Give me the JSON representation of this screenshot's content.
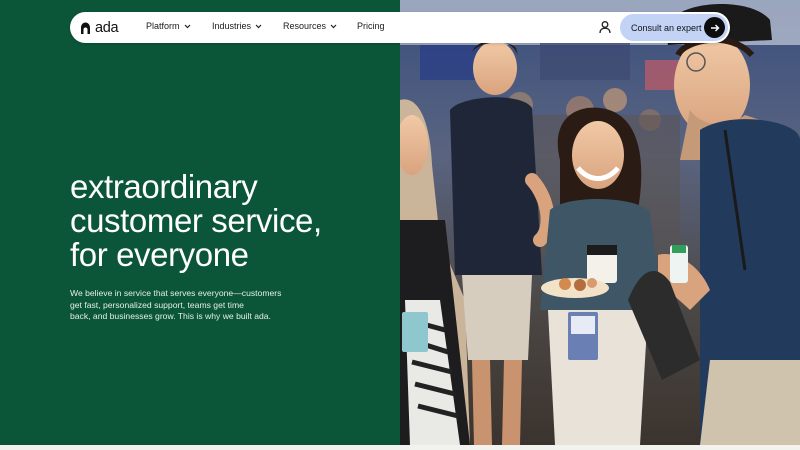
{
  "nav": {
    "logo_text": "ada",
    "items": [
      {
        "label": "Platform",
        "has_dropdown": true
      },
      {
        "label": "Industries",
        "has_dropdown": true
      },
      {
        "label": "Resources",
        "has_dropdown": true
      },
      {
        "label": "Pricing",
        "has_dropdown": false
      }
    ],
    "cta_label": "Consult an expert",
    "icons": {
      "user": "user-icon",
      "arrow": "arrow-right-icon",
      "chevron": "chevron-down-icon",
      "logo": "ada-logo-mark"
    }
  },
  "hero": {
    "title_lines": [
      "extraordinary",
      "customer service,",
      "for everyone"
    ],
    "body_lines": [
      "We believe in service that serves everyone—customers",
      "get fast, personalized support, teams get time",
      "back, and businesses grow. This is why we built ada."
    ]
  },
  "colors": {
    "panel_green": "#0b5638",
    "cta_blue": "#c3d3f6",
    "text_white": "#ffffff"
  }
}
